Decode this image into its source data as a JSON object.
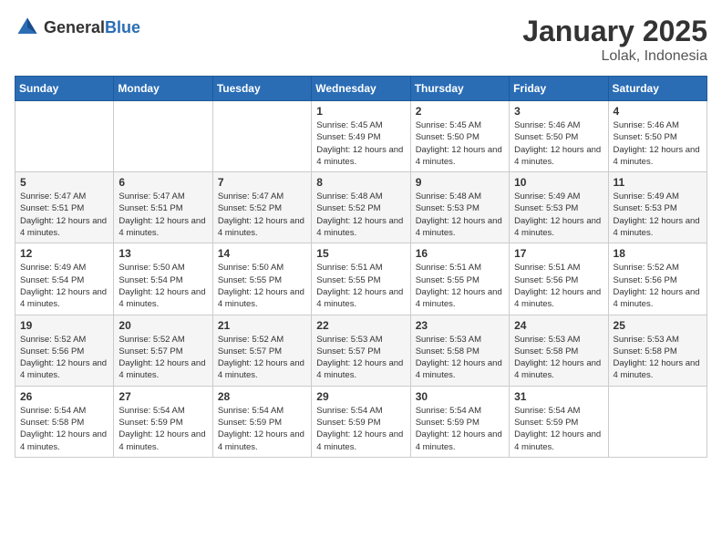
{
  "header": {
    "logo": {
      "general": "General",
      "blue": "Blue"
    },
    "title": "January 2025",
    "location": "Lolak, Indonesia"
  },
  "weekdays": [
    "Sunday",
    "Monday",
    "Tuesday",
    "Wednesday",
    "Thursday",
    "Friday",
    "Saturday"
  ],
  "weeks": [
    [
      {
        "day": "",
        "info": ""
      },
      {
        "day": "",
        "info": ""
      },
      {
        "day": "",
        "info": ""
      },
      {
        "day": "1",
        "info": "Sunrise: 5:45 AM\nSunset: 5:49 PM\nDaylight: 12 hours and 4 minutes."
      },
      {
        "day": "2",
        "info": "Sunrise: 5:45 AM\nSunset: 5:50 PM\nDaylight: 12 hours and 4 minutes."
      },
      {
        "day": "3",
        "info": "Sunrise: 5:46 AM\nSunset: 5:50 PM\nDaylight: 12 hours and 4 minutes."
      },
      {
        "day": "4",
        "info": "Sunrise: 5:46 AM\nSunset: 5:50 PM\nDaylight: 12 hours and 4 minutes."
      }
    ],
    [
      {
        "day": "5",
        "info": "Sunrise: 5:47 AM\nSunset: 5:51 PM\nDaylight: 12 hours and 4 minutes."
      },
      {
        "day": "6",
        "info": "Sunrise: 5:47 AM\nSunset: 5:51 PM\nDaylight: 12 hours and 4 minutes."
      },
      {
        "day": "7",
        "info": "Sunrise: 5:47 AM\nSunset: 5:52 PM\nDaylight: 12 hours and 4 minutes."
      },
      {
        "day": "8",
        "info": "Sunrise: 5:48 AM\nSunset: 5:52 PM\nDaylight: 12 hours and 4 minutes."
      },
      {
        "day": "9",
        "info": "Sunrise: 5:48 AM\nSunset: 5:53 PM\nDaylight: 12 hours and 4 minutes."
      },
      {
        "day": "10",
        "info": "Sunrise: 5:49 AM\nSunset: 5:53 PM\nDaylight: 12 hours and 4 minutes."
      },
      {
        "day": "11",
        "info": "Sunrise: 5:49 AM\nSunset: 5:53 PM\nDaylight: 12 hours and 4 minutes."
      }
    ],
    [
      {
        "day": "12",
        "info": "Sunrise: 5:49 AM\nSunset: 5:54 PM\nDaylight: 12 hours and 4 minutes."
      },
      {
        "day": "13",
        "info": "Sunrise: 5:50 AM\nSunset: 5:54 PM\nDaylight: 12 hours and 4 minutes."
      },
      {
        "day": "14",
        "info": "Sunrise: 5:50 AM\nSunset: 5:55 PM\nDaylight: 12 hours and 4 minutes."
      },
      {
        "day": "15",
        "info": "Sunrise: 5:51 AM\nSunset: 5:55 PM\nDaylight: 12 hours and 4 minutes."
      },
      {
        "day": "16",
        "info": "Sunrise: 5:51 AM\nSunset: 5:55 PM\nDaylight: 12 hours and 4 minutes."
      },
      {
        "day": "17",
        "info": "Sunrise: 5:51 AM\nSunset: 5:56 PM\nDaylight: 12 hours and 4 minutes."
      },
      {
        "day": "18",
        "info": "Sunrise: 5:52 AM\nSunset: 5:56 PM\nDaylight: 12 hours and 4 minutes."
      }
    ],
    [
      {
        "day": "19",
        "info": "Sunrise: 5:52 AM\nSunset: 5:56 PM\nDaylight: 12 hours and 4 minutes."
      },
      {
        "day": "20",
        "info": "Sunrise: 5:52 AM\nSunset: 5:57 PM\nDaylight: 12 hours and 4 minutes."
      },
      {
        "day": "21",
        "info": "Sunrise: 5:52 AM\nSunset: 5:57 PM\nDaylight: 12 hours and 4 minutes."
      },
      {
        "day": "22",
        "info": "Sunrise: 5:53 AM\nSunset: 5:57 PM\nDaylight: 12 hours and 4 minutes."
      },
      {
        "day": "23",
        "info": "Sunrise: 5:53 AM\nSunset: 5:58 PM\nDaylight: 12 hours and 4 minutes."
      },
      {
        "day": "24",
        "info": "Sunrise: 5:53 AM\nSunset: 5:58 PM\nDaylight: 12 hours and 4 minutes."
      },
      {
        "day": "25",
        "info": "Sunrise: 5:53 AM\nSunset: 5:58 PM\nDaylight: 12 hours and 4 minutes."
      }
    ],
    [
      {
        "day": "26",
        "info": "Sunrise: 5:54 AM\nSunset: 5:58 PM\nDaylight: 12 hours and 4 minutes."
      },
      {
        "day": "27",
        "info": "Sunrise: 5:54 AM\nSunset: 5:59 PM\nDaylight: 12 hours and 4 minutes."
      },
      {
        "day": "28",
        "info": "Sunrise: 5:54 AM\nSunset: 5:59 PM\nDaylight: 12 hours and 4 minutes."
      },
      {
        "day": "29",
        "info": "Sunrise: 5:54 AM\nSunset: 5:59 PM\nDaylight: 12 hours and 4 minutes."
      },
      {
        "day": "30",
        "info": "Sunrise: 5:54 AM\nSunset: 5:59 PM\nDaylight: 12 hours and 4 minutes."
      },
      {
        "day": "31",
        "info": "Sunrise: 5:54 AM\nSunset: 5:59 PM\nDaylight: 12 hours and 4 minutes."
      },
      {
        "day": "",
        "info": ""
      }
    ]
  ]
}
